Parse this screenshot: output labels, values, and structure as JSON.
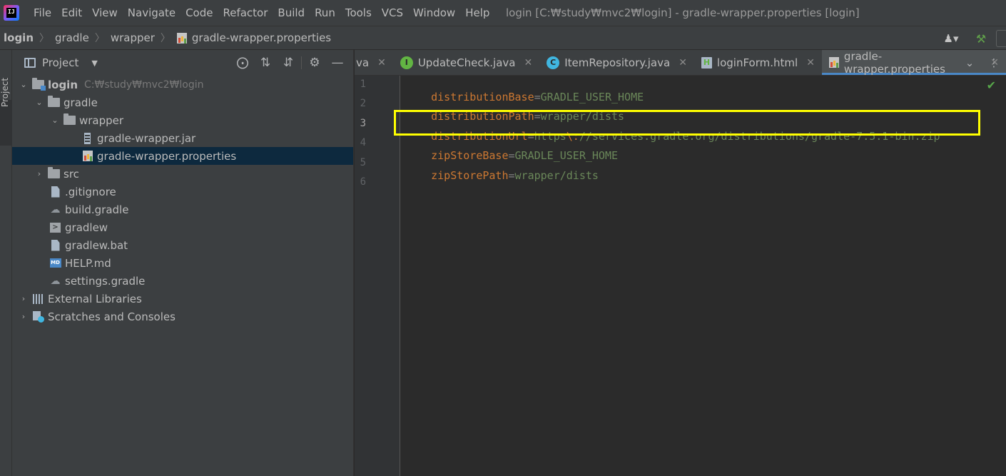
{
  "menu": {
    "items": [
      "File",
      "Edit",
      "View",
      "Navigate",
      "Code",
      "Refactor",
      "Build",
      "Run",
      "Tools",
      "VCS",
      "Window",
      "Help"
    ],
    "window_title": "login [C:₩study₩mvc2₩login] - gradle-wrapper.properties [login]"
  },
  "breadcrumb": [
    "login",
    "gradle",
    "wrapper",
    "gradle-wrapper.properties"
  ],
  "toolstrip": {
    "label": "Project"
  },
  "project_panel": {
    "title": "Project",
    "tree": [
      {
        "label": "login",
        "path": "C:₩study₩mvc2₩login"
      },
      {
        "label": "gradle"
      },
      {
        "label": "wrapper"
      },
      {
        "label": "gradle-wrapper.jar"
      },
      {
        "label": "gradle-wrapper.properties"
      },
      {
        "label": "src"
      },
      {
        "label": ".gitignore"
      },
      {
        "label": "build.gradle"
      },
      {
        "label": "gradlew"
      },
      {
        "label": "gradlew.bat"
      },
      {
        "label": "HELP.md"
      },
      {
        "label": "settings.gradle"
      },
      {
        "label": "External Libraries"
      },
      {
        "label": "Scratches and Consoles"
      }
    ]
  },
  "tabs": [
    {
      "label": "va"
    },
    {
      "label": "UpdateCheck.java"
    },
    {
      "label": "ItemRepository.java"
    },
    {
      "label": "loginForm.html"
    },
    {
      "label": "gradle-wrapper.properties"
    }
  ],
  "editor": {
    "lines": [
      {
        "num": "1",
        "key": "distributionBase",
        "eq": "=",
        "value": "GRADLE_USER_HOME"
      },
      {
        "num": "2",
        "key": "distributionPath",
        "eq": "=",
        "value": "wrapper/dists"
      },
      {
        "num": "3",
        "key": "distributionUrl",
        "eq": "=",
        "value_a": "https",
        "esc": "\\:",
        "value_b": "//services.gradle.org/distributions/gradle-7.5.1-bin.zip"
      },
      {
        "num": "4",
        "key": "zipStoreBase",
        "eq": "=",
        "value": "GRADLE_USER_HOME"
      },
      {
        "num": "5",
        "key": "zipStorePath",
        "eq": "=",
        "value": "wrapper/dists"
      },
      {
        "num": "6"
      }
    ],
    "highlight_color": "#ffff00"
  },
  "colors": {
    "key": "#cc7832",
    "value": "#6a8759",
    "background": "#2b2b2b",
    "panel": "#3c3f41",
    "selection": "#0d293e",
    "accent": "#4a88c7"
  }
}
